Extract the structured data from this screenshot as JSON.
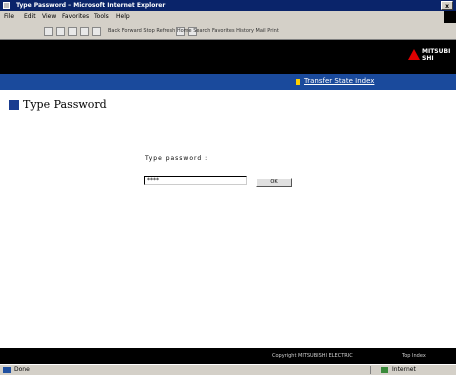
{
  "window": {
    "title": "Type Password – Microsoft Internet Explorer",
    "close_label": "x"
  },
  "menu": {
    "items": [
      "File",
      "Edit",
      "View",
      "Favorites",
      "Tools",
      "Help"
    ]
  },
  "toolbar": {
    "address_text": "Back  Forward  Stop  Refresh  Home  Search  Favorites  History  Mail  Print"
  },
  "header": {
    "logo_text_line1": "MITSUBI",
    "logo_text_line2": "SHI"
  },
  "nav": {
    "link_label": "Transfer State Index"
  },
  "page": {
    "title": "Type Password"
  },
  "form": {
    "label": "Type password :",
    "password_value": "****",
    "ok_label": "OK"
  },
  "footer": {
    "left_text": "Copyright MITSUBISHI ELECTRIC",
    "right_text": "Top Index"
  },
  "status": {
    "left_text": "Done",
    "right_text": "Internet"
  }
}
